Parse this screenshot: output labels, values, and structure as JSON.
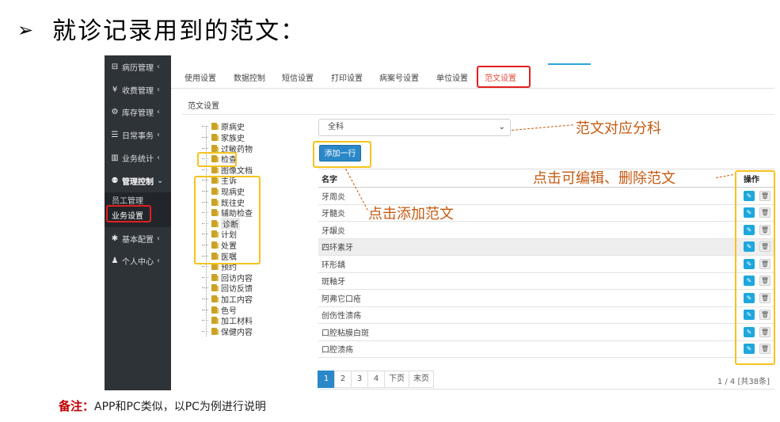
{
  "slide": {
    "title": "就诊记录用到的范文：",
    "arrow": "➢",
    "note_label": "备注：",
    "note_text": "APP和PC类似，以PC为例进行说明"
  },
  "sidebar": {
    "items": [
      {
        "icon": "bed-icon",
        "glyph": "⊟",
        "label": "病历管理",
        "chev": "‹"
      },
      {
        "icon": "yen-icon",
        "glyph": "¥",
        "label": "收费管理",
        "chev": "‹"
      },
      {
        "icon": "cubes-icon",
        "glyph": "⚙",
        "label": "库存管理",
        "chev": "‹"
      },
      {
        "icon": "list-icon",
        "glyph": "☰",
        "label": "日常事务",
        "chev": "‹"
      },
      {
        "icon": "bar-chart-icon",
        "glyph": "▥",
        "label": "业务统计",
        "chev": "‹"
      },
      {
        "icon": "cog-icon",
        "glyph": "⚉",
        "label": "管理控制",
        "chev": "⌄"
      }
    ],
    "sub_items": [
      "员工管理",
      "业务设置"
    ],
    "bottom_items": [
      {
        "icon": "wrench-icon",
        "glyph": "✱",
        "label": "基本配置",
        "chev": "‹"
      },
      {
        "icon": "user-icon",
        "glyph": "♟",
        "label": "个人中心",
        "chev": "‹"
      }
    ]
  },
  "tabs": [
    "使用设置",
    "数据控制",
    "短信设置",
    "打印设置",
    "病案号设置",
    "单位设置",
    "范文设置"
  ],
  "section_title": "范文设置",
  "tree": [
    "原病史",
    "家族史",
    "过敏药物",
    "检查",
    "图像文档",
    "主诉",
    "现病史",
    "既往史",
    "辅助检查",
    "诊断",
    "计划",
    "处置",
    "医嘱",
    "预约",
    "回访内容",
    "回访反馈",
    "加工内容",
    "色号",
    "加工材料",
    "保健内容"
  ],
  "select": {
    "value": "全科",
    "caret": "⌄"
  },
  "add_button": "添加一行",
  "table": {
    "headers": {
      "name": "名字",
      "op": "操作"
    },
    "rows": [
      "牙周炎",
      "牙髓炎",
      "牙龈炎",
      "四环素牙",
      "环形龋",
      "斑釉牙",
      "阿弗它口疮",
      "创伤性溃疡",
      "口腔粘膜白斑",
      "口腔溃疡"
    ],
    "edit_glyph": "✎",
    "delete_glyph": "🗑"
  },
  "pagination": {
    "pages": [
      "1",
      "2",
      "3",
      "4",
      "下页",
      "末页"
    ],
    "info": "1 / 4  [共38条]"
  },
  "annotations": {
    "dept": "范文对应分科",
    "edit": "点击可编辑、删除范文",
    "add": "点击添加范文"
  }
}
